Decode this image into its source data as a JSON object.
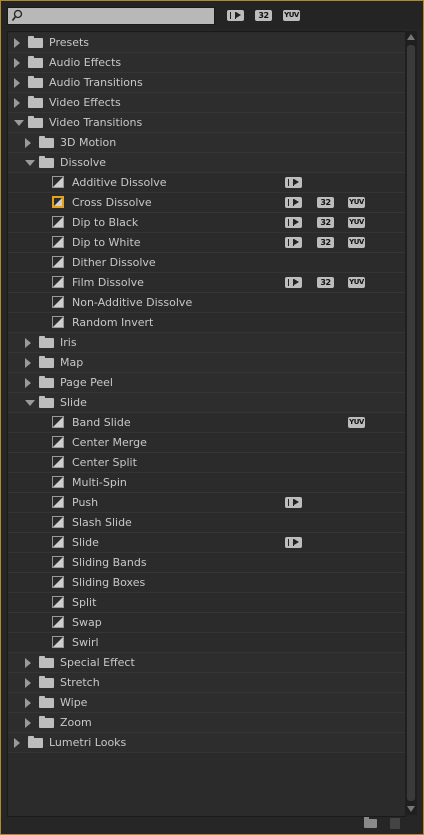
{
  "search": {
    "placeholder": "",
    "value": ""
  },
  "filters": [
    {
      "icon": "accelerated-effects-icon",
      "label": ""
    },
    {
      "icon": "32-bit-effects-icon",
      "label": "32"
    },
    {
      "icon": "yuv-effects-icon",
      "label": "YUV"
    }
  ],
  "rows": [
    {
      "type": "bin",
      "depth": 0,
      "expanded": false,
      "label": "Presets",
      "icon": "presets-folder-icon"
    },
    {
      "type": "bin",
      "depth": 0,
      "expanded": false,
      "label": "Audio Effects"
    },
    {
      "type": "bin",
      "depth": 0,
      "expanded": false,
      "label": "Audio Transitions"
    },
    {
      "type": "bin",
      "depth": 0,
      "expanded": false,
      "label": "Video Effects"
    },
    {
      "type": "bin",
      "depth": 0,
      "expanded": true,
      "label": "Video Transitions"
    },
    {
      "type": "bin",
      "depth": 1,
      "expanded": false,
      "label": "3D Motion"
    },
    {
      "type": "bin",
      "depth": 1,
      "expanded": true,
      "label": "Dissolve"
    },
    {
      "type": "effect",
      "depth": 2,
      "label": "Additive Dissolve",
      "badges": [
        "accel"
      ]
    },
    {
      "type": "effect",
      "depth": 2,
      "label": "Cross Dissolve",
      "selected": true,
      "badges": [
        "accel",
        "32",
        "yuv"
      ]
    },
    {
      "type": "effect",
      "depth": 2,
      "label": "Dip to Black",
      "badges": [
        "accel",
        "32",
        "yuv"
      ]
    },
    {
      "type": "effect",
      "depth": 2,
      "label": "Dip to White",
      "badges": [
        "accel",
        "32",
        "yuv"
      ]
    },
    {
      "type": "effect",
      "depth": 2,
      "label": "Dither Dissolve",
      "badges": []
    },
    {
      "type": "effect",
      "depth": 2,
      "label": "Film Dissolve",
      "badges": [
        "accel",
        "32",
        "yuv"
      ]
    },
    {
      "type": "effect",
      "depth": 2,
      "label": "Non-Additive Dissolve",
      "badges": []
    },
    {
      "type": "effect",
      "depth": 2,
      "label": "Random Invert",
      "badges": []
    },
    {
      "type": "bin",
      "depth": 1,
      "expanded": false,
      "label": "Iris"
    },
    {
      "type": "bin",
      "depth": 1,
      "expanded": false,
      "label": "Map"
    },
    {
      "type": "bin",
      "depth": 1,
      "expanded": false,
      "label": "Page Peel"
    },
    {
      "type": "bin",
      "depth": 1,
      "expanded": true,
      "label": "Slide"
    },
    {
      "type": "effect",
      "depth": 2,
      "label": "Band Slide",
      "badges": [
        "yuv"
      ]
    },
    {
      "type": "effect",
      "depth": 2,
      "label": "Center Merge",
      "badges": []
    },
    {
      "type": "effect",
      "depth": 2,
      "label": "Center Split",
      "badges": []
    },
    {
      "type": "effect",
      "depth": 2,
      "label": "Multi-Spin",
      "badges": []
    },
    {
      "type": "effect",
      "depth": 2,
      "label": "Push",
      "badges": [
        "accel"
      ]
    },
    {
      "type": "effect",
      "depth": 2,
      "label": "Slash Slide",
      "badges": []
    },
    {
      "type": "effect",
      "depth": 2,
      "label": "Slide",
      "badges": [
        "accel"
      ]
    },
    {
      "type": "effect",
      "depth": 2,
      "label": "Sliding Bands",
      "badges": []
    },
    {
      "type": "effect",
      "depth": 2,
      "label": "Sliding Boxes",
      "badges": []
    },
    {
      "type": "effect",
      "depth": 2,
      "label": "Split",
      "badges": []
    },
    {
      "type": "effect",
      "depth": 2,
      "label": "Swap",
      "badges": []
    },
    {
      "type": "effect",
      "depth": 2,
      "label": "Swirl",
      "badges": []
    },
    {
      "type": "bin",
      "depth": 1,
      "expanded": false,
      "label": "Special Effect"
    },
    {
      "type": "bin",
      "depth": 1,
      "expanded": false,
      "label": "Stretch"
    },
    {
      "type": "bin",
      "depth": 1,
      "expanded": false,
      "label": "Wipe"
    },
    {
      "type": "bin",
      "depth": 1,
      "expanded": false,
      "label": "Zoom"
    },
    {
      "type": "bin",
      "depth": 0,
      "expanded": false,
      "label": "Lumetri Looks"
    }
  ],
  "footer": [
    {
      "icon": "new-custom-bin-icon"
    },
    {
      "icon": "delete-icon"
    }
  ],
  "colors": {
    "selection_outline": "#e8a11a",
    "panel_border": "#b08a2a"
  }
}
